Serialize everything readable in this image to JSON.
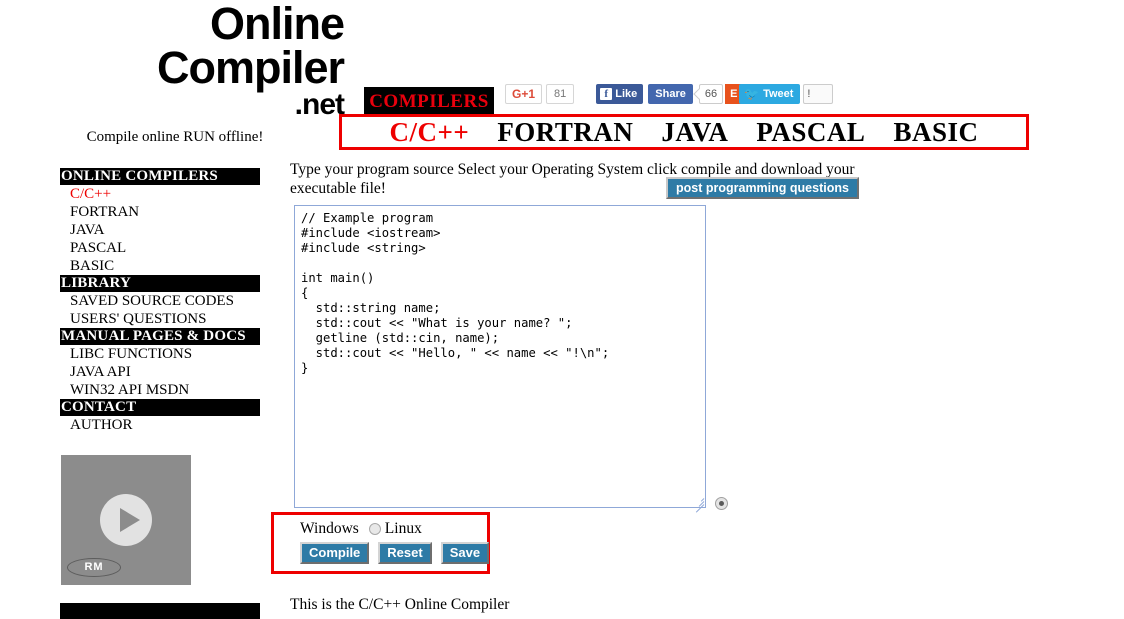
{
  "site": {
    "logo_line_1": "Online",
    "logo_line_2": "Compiler",
    "logo_line_3": ".net",
    "tagline": "Compile online RUN offline!",
    "compilers_badge": "COMPILERS"
  },
  "social": {
    "gplus_label": "G+1",
    "gplus_count": "81",
    "facebook_icon": "f",
    "facebook_like_label": "Like",
    "facebook_share_label": "Share",
    "facebook_count": "66",
    "reddit_label": "E",
    "twitter_bird": "ᵛ",
    "twitter_label": "Tweet",
    "twitter_count": "!"
  },
  "language_bar": {
    "items": [
      {
        "label": "C/C++",
        "active": true
      },
      {
        "label": "FORTRAN",
        "active": false
      },
      {
        "label": "JAVA",
        "active": false
      },
      {
        "label": "PASCAL",
        "active": false
      },
      {
        "label": "BASIC",
        "active": false
      }
    ]
  },
  "sidebar": {
    "sections": [
      {
        "header": "ONLINE COMPILERS",
        "items": [
          {
            "label": "C/C++",
            "active": true
          },
          {
            "label": "FORTRAN",
            "active": false
          },
          {
            "label": "JAVA",
            "active": false
          },
          {
            "label": "PASCAL",
            "active": false
          },
          {
            "label": "BASIC",
            "active": false
          }
        ]
      },
      {
        "header": "LIBRARY",
        "items": [
          {
            "label": "SAVED SOURCE CODES",
            "active": false
          },
          {
            "label": "USERS' QUESTIONS",
            "active": false
          }
        ]
      },
      {
        "header": "MANUAL PAGES & DOCS",
        "items": [
          {
            "label": "LIBC FUNCTIONS",
            "active": false
          },
          {
            "label": "JAVA API",
            "active": false
          },
          {
            "label": "WIN32 API MSDN",
            "active": false
          }
        ]
      },
      {
        "header": "CONTACT",
        "items": [
          {
            "label": "AUTHOR",
            "active": false
          }
        ]
      }
    ]
  },
  "video": {
    "watermark": "RM",
    "play_icon": "play-icon"
  },
  "main": {
    "instructions": "Type your program source Select your Operating System click compile and download your executable file!",
    "post_questions_label": "post programming questions",
    "code": "// Example program\n#include <iostream>\n#include <string>\n\nint main()\n{\n  std::string name;\n  std::cout << \"What is your name? \";\n  getline (std::cin, name);\n  std::cout << \"Hello, \" << name << \"!\\n\";\n}",
    "os_windows_label": "Windows",
    "os_linux_label": "Linux",
    "compile_label": "Compile",
    "reset_label": "Reset",
    "save_label": "Save",
    "footer_note": "This is the C/C++ Online Compiler"
  },
  "colors": {
    "accent_red": "#ee0000",
    "button_blue": "#2e7ba6",
    "header_black": "#000000",
    "editor_border": "#8fa8d8"
  }
}
